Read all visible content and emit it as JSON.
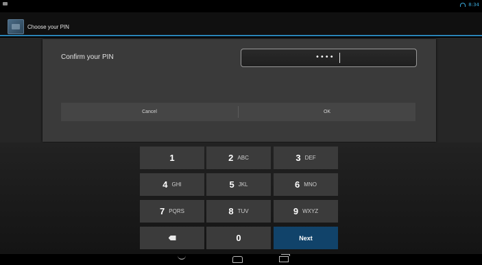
{
  "status_bar": {
    "time": "8:34",
    "left_icon": "notification-icon",
    "wifi_icon": "wifi-icon"
  },
  "action_bar": {
    "title": "Choose your PIN",
    "icon": "app-icon"
  },
  "dialog": {
    "label": "Confirm your PIN",
    "pin_value": "••••",
    "cancel_label": "Cancel",
    "ok_label": "OK"
  },
  "keypad": {
    "keys": [
      {
        "num": "1",
        "letters": ""
      },
      {
        "num": "2",
        "letters": "ABC"
      },
      {
        "num": "3",
        "letters": "DEF"
      },
      {
        "num": "4",
        "letters": "GHI"
      },
      {
        "num": "5",
        "letters": "JKL"
      },
      {
        "num": "6",
        "letters": "MNO"
      },
      {
        "num": "7",
        "letters": "PQRS"
      },
      {
        "num": "8",
        "letters": "TUV"
      },
      {
        "num": "9",
        "letters": "WXYZ"
      },
      {
        "num": "",
        "letters": "",
        "icon": "backspace-icon"
      },
      {
        "num": "0",
        "letters": ""
      },
      {
        "num": "Next",
        "letters": ""
      }
    ]
  },
  "nav_bar": {
    "back_icon": "back-icon",
    "home_icon": "home-icon",
    "recent_icon": "recent-apps-icon"
  },
  "colors": {
    "accent": "#2b86b8",
    "next_key": "#11436a",
    "status_text": "#3aa8d8"
  }
}
